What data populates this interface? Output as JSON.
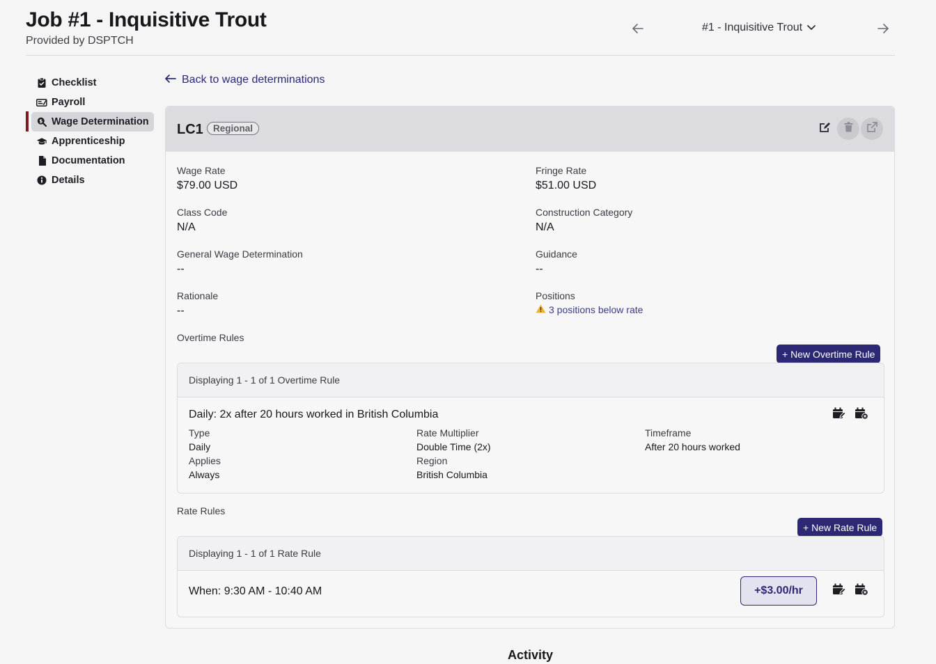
{
  "header": {
    "title": "Job #1 - Inquisitive Trout",
    "subtitle": "Provided by DSPTCH",
    "job_selector": "#1 - Inquisitive Trout"
  },
  "sidebar": {
    "items": [
      {
        "label": "Checklist",
        "icon": "clipboard-check-icon"
      },
      {
        "label": "Payroll",
        "icon": "money-check-icon"
      },
      {
        "label": "Wage Determination",
        "icon": "search-dollar-icon",
        "active": true
      },
      {
        "label": "Apprenticeship",
        "icon": "graduation-cap-icon"
      },
      {
        "label": "Documentation",
        "icon": "file-icon"
      },
      {
        "label": "Details",
        "icon": "info-circle-icon"
      }
    ]
  },
  "back_link": "Back to wage determinations",
  "card": {
    "title": "LC1",
    "badge": "Regional",
    "fields": {
      "wage_rate": {
        "label": "Wage Rate",
        "value": "$79.00 USD"
      },
      "fringe_rate": {
        "label": "Fringe Rate",
        "value": "$51.00 USD"
      },
      "class_code": {
        "label": "Class Code",
        "value": "N/A"
      },
      "construction_category": {
        "label": "Construction Category",
        "value": "N/A"
      },
      "general_wage_determination": {
        "label": "General Wage Determination",
        "value": "--"
      },
      "guidance": {
        "label": "Guidance",
        "value": "--"
      },
      "rationale": {
        "label": "Rationale",
        "value": "--"
      },
      "positions": {
        "label": "Positions",
        "value": "3 positions below rate"
      }
    }
  },
  "overtime": {
    "section_label": "Overtime Rules",
    "new_button": "+ New Overtime Rule",
    "displaying": "Displaying 1 - 1 of 1 Overtime Rule",
    "rule": {
      "title": "Daily: 2x after 20 hours worked in British Columbia",
      "type_label": "Type",
      "type_value": "Daily",
      "applies_label": "Applies",
      "applies_value": "Always",
      "multiplier_label": "Rate Multiplier",
      "multiplier_value": "Double Time (2x)",
      "region_label": "Region",
      "region_value": "British Columbia",
      "timeframe_label": "Timeframe",
      "timeframe_value": "After 20 hours worked"
    }
  },
  "rate": {
    "section_label": "Rate Rules",
    "new_button": "+ New Rate Rule",
    "displaying": "Displaying 1 - 1 of 1 Rate Rule",
    "rule": {
      "when": "When: 9:30 AM - 10:40 AM",
      "amount": "+$3.00/hr"
    }
  },
  "activity_title": "Activity",
  "colors": {
    "primary": "#2c2873",
    "active_marker": "#7a1c22",
    "warning": "#f0b429"
  }
}
